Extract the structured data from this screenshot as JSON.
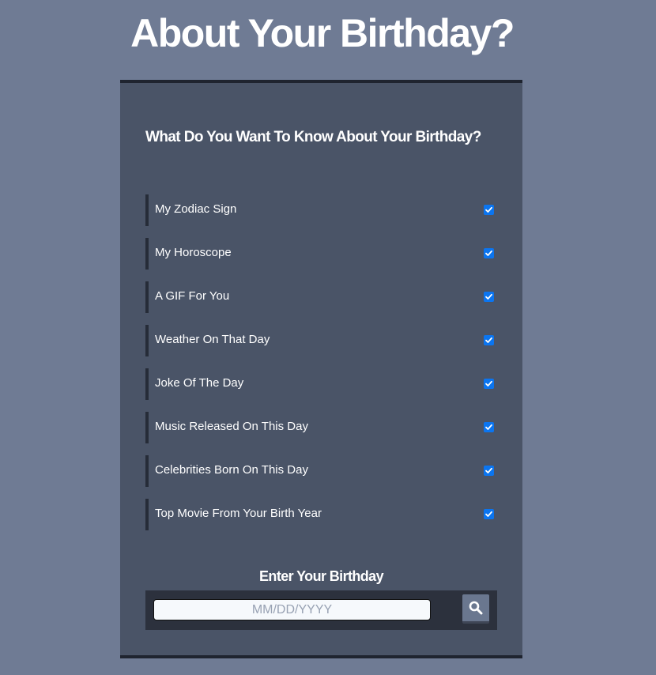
{
  "page": {
    "title": "About Your Birthday?"
  },
  "form": {
    "heading": "What Do You Want To Know About Your Birthday?",
    "options": [
      {
        "label": "My Zodiac Sign",
        "checked": true
      },
      {
        "label": "My Horoscope",
        "checked": true
      },
      {
        "label": "A GIF For You",
        "checked": true
      },
      {
        "label": "Weather On That Day",
        "checked": true
      },
      {
        "label": "Joke Of The Day",
        "checked": true
      },
      {
        "label": "Music Released On This Day",
        "checked": true
      },
      {
        "label": "Celebrities Born On This Day",
        "checked": true
      },
      {
        "label": "Top Movie From Your Birth Year",
        "checked": true
      }
    ],
    "birthday_label": "Enter Your Birthday",
    "birthday_input": {
      "value": "",
      "placeholder": "MM/DD/YYYY"
    },
    "search_button": {
      "icon": "search-icon"
    }
  },
  "colors": {
    "background": "#6f7b94",
    "card": "#4a5467",
    "checkbox": "#0b75f0",
    "input_bar": "#2c313d"
  }
}
